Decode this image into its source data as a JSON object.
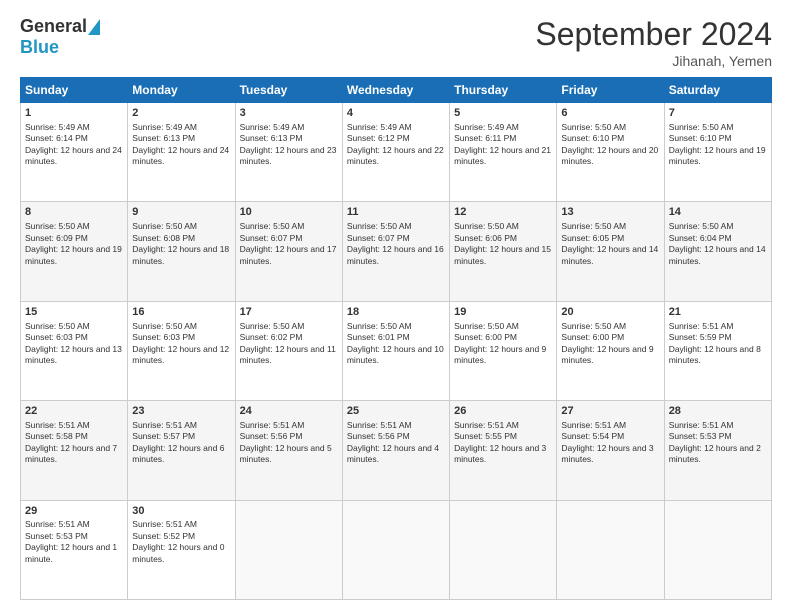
{
  "header": {
    "logo_general": "General",
    "logo_blue": "Blue",
    "month_title": "September 2024",
    "location": "Jihanah, Yemen"
  },
  "days_of_week": [
    "Sunday",
    "Monday",
    "Tuesday",
    "Wednesday",
    "Thursday",
    "Friday",
    "Saturday"
  ],
  "weeks": [
    [
      {
        "day": "1",
        "sunrise": "5:49 AM",
        "sunset": "6:14 PM",
        "daylight": "12 hours and 24 minutes."
      },
      {
        "day": "2",
        "sunrise": "5:49 AM",
        "sunset": "6:13 PM",
        "daylight": "12 hours and 24 minutes."
      },
      {
        "day": "3",
        "sunrise": "5:49 AM",
        "sunset": "6:13 PM",
        "daylight": "12 hours and 23 minutes."
      },
      {
        "day": "4",
        "sunrise": "5:49 AM",
        "sunset": "6:12 PM",
        "daylight": "12 hours and 22 minutes."
      },
      {
        "day": "5",
        "sunrise": "5:49 AM",
        "sunset": "6:11 PM",
        "daylight": "12 hours and 21 minutes."
      },
      {
        "day": "6",
        "sunrise": "5:50 AM",
        "sunset": "6:10 PM",
        "daylight": "12 hours and 20 minutes."
      },
      {
        "day": "7",
        "sunrise": "5:50 AM",
        "sunset": "6:10 PM",
        "daylight": "12 hours and 19 minutes."
      }
    ],
    [
      {
        "day": "8",
        "sunrise": "5:50 AM",
        "sunset": "6:09 PM",
        "daylight": "12 hours and 19 minutes."
      },
      {
        "day": "9",
        "sunrise": "5:50 AM",
        "sunset": "6:08 PM",
        "daylight": "12 hours and 18 minutes."
      },
      {
        "day": "10",
        "sunrise": "5:50 AM",
        "sunset": "6:07 PM",
        "daylight": "12 hours and 17 minutes."
      },
      {
        "day": "11",
        "sunrise": "5:50 AM",
        "sunset": "6:07 PM",
        "daylight": "12 hours and 16 minutes."
      },
      {
        "day": "12",
        "sunrise": "5:50 AM",
        "sunset": "6:06 PM",
        "daylight": "12 hours and 15 minutes."
      },
      {
        "day": "13",
        "sunrise": "5:50 AM",
        "sunset": "6:05 PM",
        "daylight": "12 hours and 14 minutes."
      },
      {
        "day": "14",
        "sunrise": "5:50 AM",
        "sunset": "6:04 PM",
        "daylight": "12 hours and 14 minutes."
      }
    ],
    [
      {
        "day": "15",
        "sunrise": "5:50 AM",
        "sunset": "6:03 PM",
        "daylight": "12 hours and 13 minutes."
      },
      {
        "day": "16",
        "sunrise": "5:50 AM",
        "sunset": "6:03 PM",
        "daylight": "12 hours and 12 minutes."
      },
      {
        "day": "17",
        "sunrise": "5:50 AM",
        "sunset": "6:02 PM",
        "daylight": "12 hours and 11 minutes."
      },
      {
        "day": "18",
        "sunrise": "5:50 AM",
        "sunset": "6:01 PM",
        "daylight": "12 hours and 10 minutes."
      },
      {
        "day": "19",
        "sunrise": "5:50 AM",
        "sunset": "6:00 PM",
        "daylight": "12 hours and 9 minutes."
      },
      {
        "day": "20",
        "sunrise": "5:50 AM",
        "sunset": "6:00 PM",
        "daylight": "12 hours and 9 minutes."
      },
      {
        "day": "21",
        "sunrise": "5:51 AM",
        "sunset": "5:59 PM",
        "daylight": "12 hours and 8 minutes."
      }
    ],
    [
      {
        "day": "22",
        "sunrise": "5:51 AM",
        "sunset": "5:58 PM",
        "daylight": "12 hours and 7 minutes."
      },
      {
        "day": "23",
        "sunrise": "5:51 AM",
        "sunset": "5:57 PM",
        "daylight": "12 hours and 6 minutes."
      },
      {
        "day": "24",
        "sunrise": "5:51 AM",
        "sunset": "5:56 PM",
        "daylight": "12 hours and 5 minutes."
      },
      {
        "day": "25",
        "sunrise": "5:51 AM",
        "sunset": "5:56 PM",
        "daylight": "12 hours and 4 minutes."
      },
      {
        "day": "26",
        "sunrise": "5:51 AM",
        "sunset": "5:55 PM",
        "daylight": "12 hours and 3 minutes."
      },
      {
        "day": "27",
        "sunrise": "5:51 AM",
        "sunset": "5:54 PM",
        "daylight": "12 hours and 3 minutes."
      },
      {
        "day": "28",
        "sunrise": "5:51 AM",
        "sunset": "5:53 PM",
        "daylight": "12 hours and 2 minutes."
      }
    ],
    [
      {
        "day": "29",
        "sunrise": "5:51 AM",
        "sunset": "5:53 PM",
        "daylight": "12 hours and 1 minute."
      },
      {
        "day": "30",
        "sunrise": "5:51 AM",
        "sunset": "5:52 PM",
        "daylight": "12 hours and 0 minutes."
      },
      null,
      null,
      null,
      null,
      null
    ]
  ]
}
